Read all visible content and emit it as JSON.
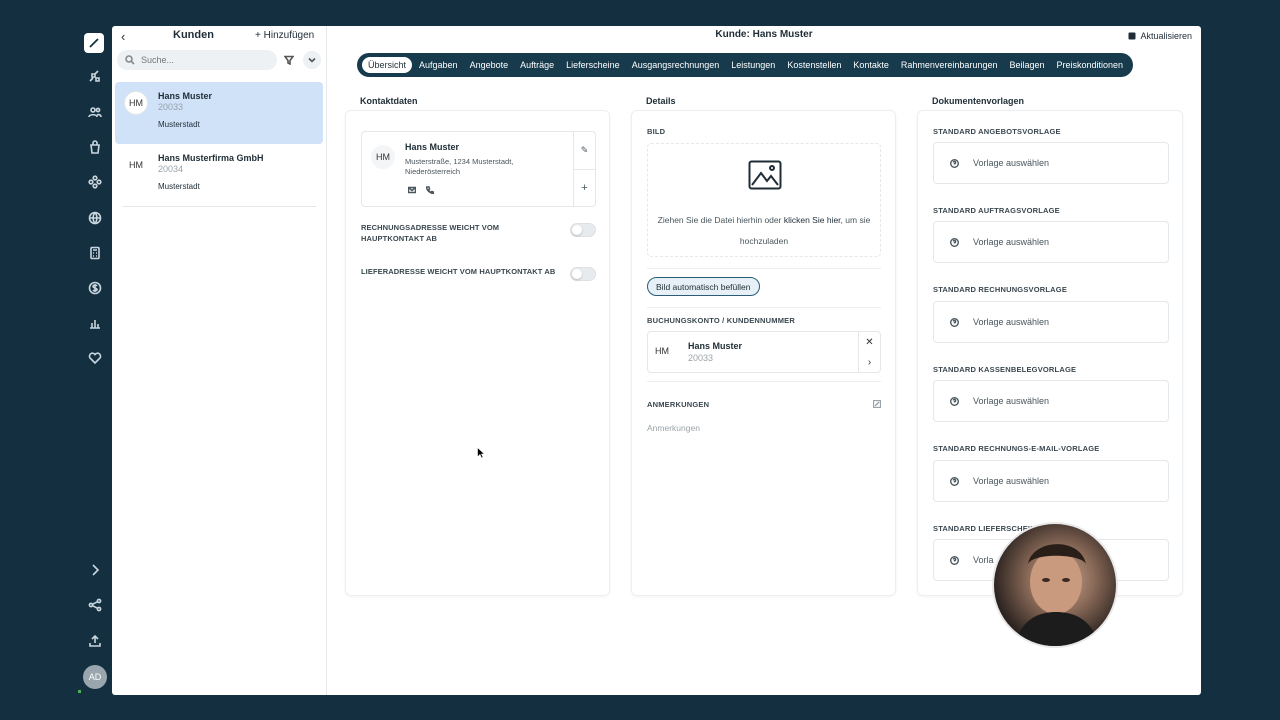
{
  "app": {
    "sidebar_avatar": "AD"
  },
  "customer_list": {
    "title": "Kunden",
    "add_label": "Hinzufügen",
    "search_placeholder": "Suche...",
    "items": [
      {
        "initials": "HM",
        "name": "Hans Muster",
        "number": "20033",
        "city": "Musterstadt",
        "active": true
      },
      {
        "initials": "HM",
        "name": "Hans Musterfirma GmbH",
        "number": "20034",
        "city": "Musterstadt",
        "active": false
      }
    ]
  },
  "header": {
    "title": "Kunde: Hans Muster",
    "refresh_label": "Aktualisieren"
  },
  "tabs": [
    {
      "label": "Übersicht",
      "active": true
    },
    {
      "label": "Aufgaben"
    },
    {
      "label": "Angebote"
    },
    {
      "label": "Aufträge"
    },
    {
      "label": "Lieferscheine"
    },
    {
      "label": "Ausgangsrechnungen"
    },
    {
      "label": "Leistungen"
    },
    {
      "label": "Kostenstellen"
    },
    {
      "label": "Kontakte"
    },
    {
      "label": "Rahmenvereinbarungen"
    },
    {
      "label": "Beilagen"
    },
    {
      "label": "Preiskonditionen"
    }
  ],
  "contact": {
    "section_label": "Kontaktdaten",
    "initials": "HM",
    "name": "Hans Muster",
    "address": "Musterstraße, 1234 Musterstadt, Niederösterreich",
    "billing_toggle_label": "RECHNUNGSADRESSE WEICHT VOM HAUPTKONTAKT AB",
    "delivery_toggle_label": "LIEFERADRESSE WEICHT VOM HAUPTKONTAKT AB"
  },
  "details": {
    "section_label": "Details",
    "image_title": "BILD",
    "drop_text_before": "Ziehen Sie die Datei hierhin oder ",
    "drop_link": "klicken Sie hier",
    "drop_text_after": ", um sie hochzuladen",
    "auto_fill_label": "Bild automatisch befüllen",
    "account_title": "BUCHUNGSKONTO / KUNDENNUMMER",
    "account_initials": "HM",
    "account_name": "Hans Muster",
    "account_number": "20033",
    "notes_title": "ANMERKUNGEN",
    "notes_placeholder": "Anmerkungen"
  },
  "templates": {
    "section_label": "Dokumentenvorlagen",
    "select_label": "Vorlage auswählen",
    "items": [
      {
        "title": "STANDARD ANGEBOTSVORLAGE",
        "value": "Vorlage auswählen"
      },
      {
        "title": "STANDARD AUFTRAGSVORLAGE",
        "value": "Vorlage auswählen"
      },
      {
        "title": "STANDARD RECHNUNGSVORLAGE",
        "value": "Vorlage auswählen"
      },
      {
        "title": "STANDARD KASSENBELEGVORLAGE",
        "value": "Vorlage auswählen"
      },
      {
        "title": "STANDARD RECHNUNGS-E-MAIL-VORLAGE",
        "value": "Vorlage auswählen"
      },
      {
        "title": "STANDARD LIEFERSCHEIN",
        "value": "Vorla"
      }
    ]
  }
}
